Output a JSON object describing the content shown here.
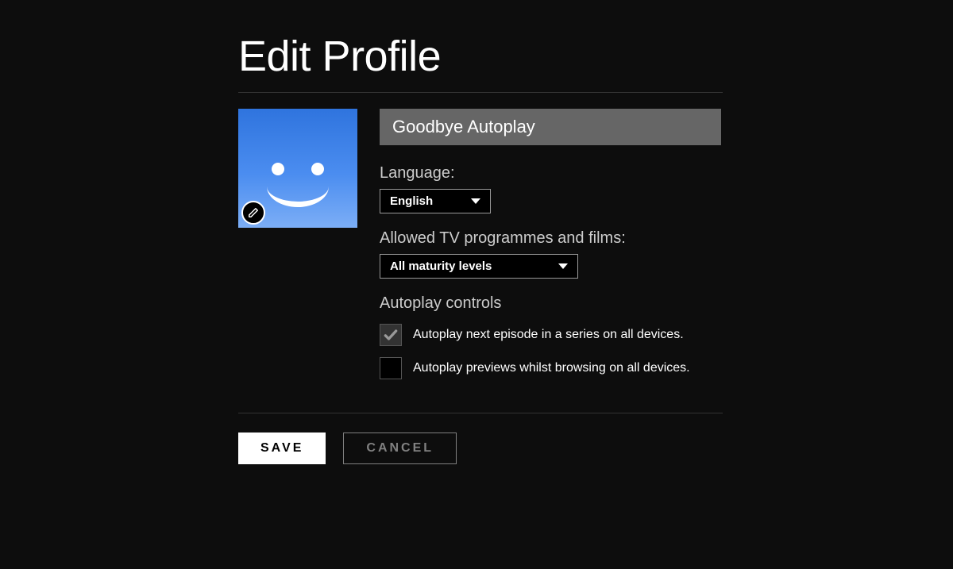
{
  "title": "Edit Profile",
  "profile": {
    "name": "Goodbye Autoplay"
  },
  "language": {
    "label": "Language:",
    "selected": "English"
  },
  "maturity": {
    "label": "Allowed TV programmes and films:",
    "selected": "All maturity levels"
  },
  "autoplay": {
    "title": "Autoplay controls",
    "options": [
      {
        "label": "Autoplay next episode in a series on all devices.",
        "checked": true
      },
      {
        "label": "Autoplay previews whilst browsing on all devices.",
        "checked": false
      }
    ]
  },
  "actions": {
    "save": "SAVE",
    "cancel": "CANCEL"
  }
}
